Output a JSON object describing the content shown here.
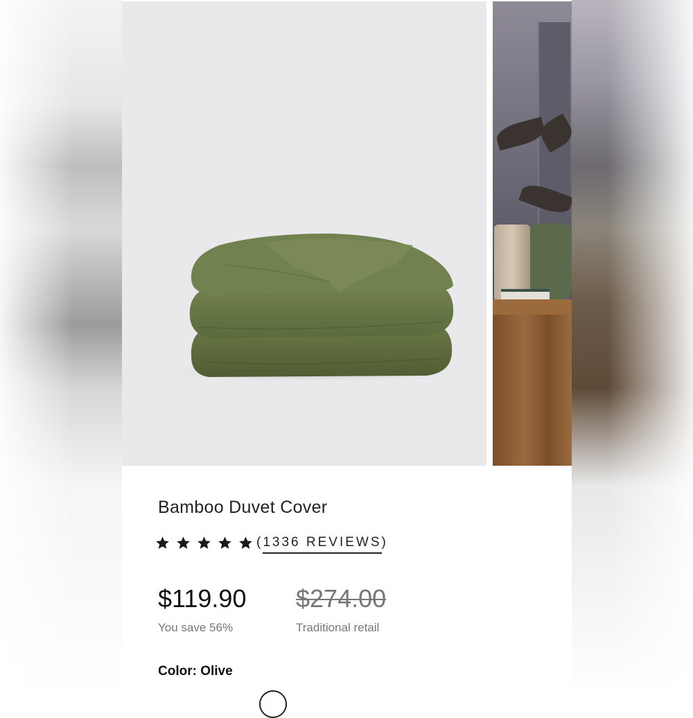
{
  "product": {
    "title": "Bamboo Duvet Cover",
    "rating_stars": 5,
    "reviews_open": "(",
    "reviews_text": "1336 REVIEWS",
    "reviews_close": ")",
    "price": "$119.90",
    "original_price": "$274.00",
    "savings_text": "You save 56%",
    "retail_text": "Traditional retail",
    "color_label": "Color:",
    "color_value": "Olive"
  },
  "colors": {
    "duvet": "#6b7a4a",
    "duvet_dark": "#55613a",
    "image_bg": "#e9e9eb",
    "star": "#1a1a1a"
  },
  "icons": {
    "star": "star-icon"
  }
}
